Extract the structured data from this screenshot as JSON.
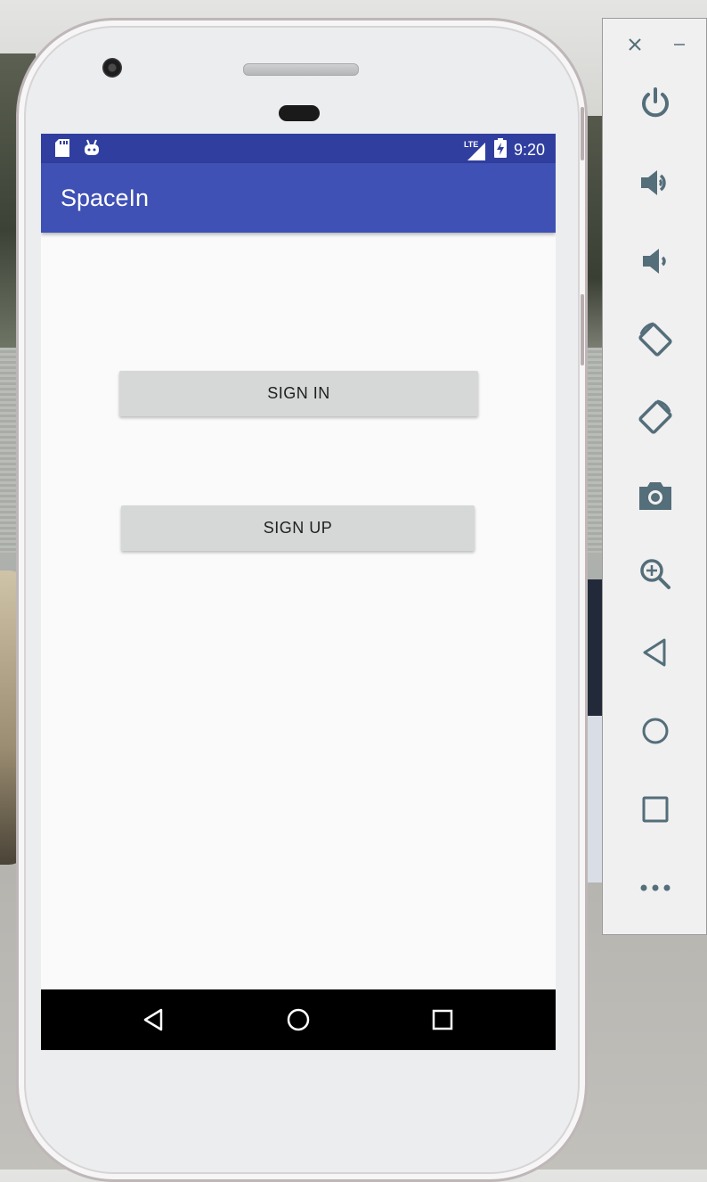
{
  "status_bar": {
    "time": "9:20",
    "network": "LTE"
  },
  "app_bar": {
    "title": "SpaceIn"
  },
  "buttons": {
    "sign_in": "SIGN IN",
    "sign_up": "SIGN UP"
  },
  "colors": {
    "status_bar": "#303f9f",
    "app_bar": "#3f51b5",
    "button": "#d6d7d7",
    "toolbar_icon": "#546e7a"
  },
  "emulator_toolbar": {
    "items": [
      "power-icon",
      "volume-up-icon",
      "volume-down-icon",
      "rotate-left-icon",
      "rotate-right-icon",
      "camera-icon",
      "zoom-icon",
      "back-icon",
      "home-icon",
      "overview-icon",
      "more-icon"
    ]
  }
}
